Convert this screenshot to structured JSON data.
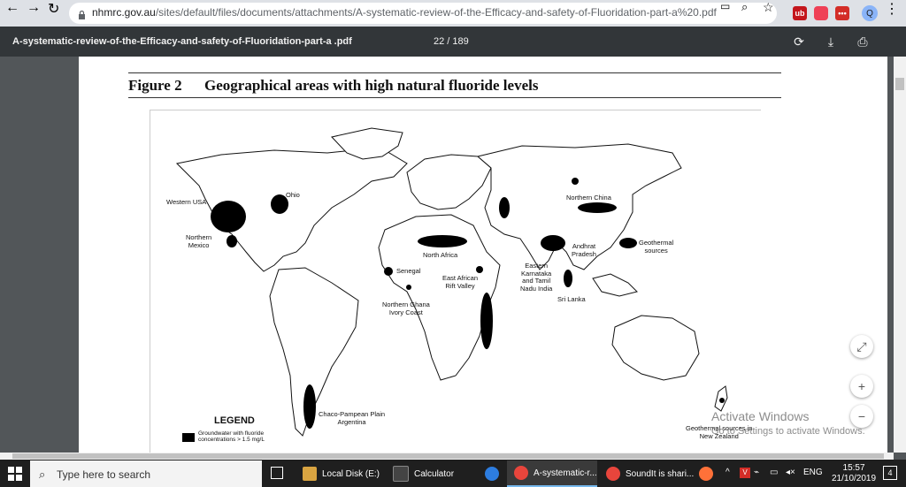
{
  "browser": {
    "url_domain": "nhmrc.gov.au",
    "url_path": "/sites/default/files/documents/attachments/A-systematic-review-of-the-Efficacy-and-safety-of-Fluoridation-part-a%20.pdf",
    "profile_initial": "Q",
    "extensions": [
      {
        "name": "ublock-icon",
        "label": "ub",
        "color": "#c4161c"
      },
      {
        "name": "pocket-icon",
        "label": "",
        "color": "#ef4056"
      },
      {
        "name": "lastpass-icon",
        "label": "•••",
        "color": "#d32d27"
      }
    ]
  },
  "pdf": {
    "title": "A-systematic-review-of-the-Efficacy-and-safety-of-Fluoridation-part-a .pdf",
    "page_indicator": "22 / 189"
  },
  "figure": {
    "label": "Figure 2",
    "caption": "Geographical areas with high natural fluoride levels",
    "regions": {
      "western_usa": "Western USA",
      "ohio": "Ohio",
      "northern_mexico_1": "Northern",
      "northern_mexico_2": "Mexico",
      "north_africa": "North Africa",
      "northern_china": "Northern China",
      "senegal": "Senegal",
      "east_african_1": "East African",
      "east_african_2": "Rift Valley",
      "andhra_1": "Andhrat",
      "andhra_2": "Pradesh",
      "eastern_1": "Eastern",
      "eastern_2": "Karnataka",
      "eastern_3": "and Tamil",
      "eastern_4": "Nadu India",
      "sri_lanka": "Sri Lanka",
      "geothermal_1": "Geothermal",
      "geothermal_2": "sources",
      "ghana_1": "Northern Ghana",
      "ghana_2": "Ivory Coast",
      "chaco_1": "Chaco-Pampean Plain",
      "chaco_2": "Argentina",
      "nz_1": "Geothermal sources in",
      "nz_2": "New Zealand"
    },
    "legend": {
      "title": "LEGEND",
      "item_1": "Groundwater with fluoride",
      "item_2": "concentrations > 1.5 mg/L"
    }
  },
  "watermark": {
    "line1": "Activate Windows",
    "line2": "Go to Settings to activate Windows."
  },
  "taskbar": {
    "search_placeholder": "Type here to search",
    "tasks": [
      {
        "name": "task-local-disk",
        "label": "Local Disk (E:)",
        "color": "#d9a441",
        "active": false
      },
      {
        "name": "task-calculator",
        "label": "Calculator",
        "color": "#444444",
        "active": false
      },
      {
        "name": "task-chrome-systematic",
        "label": "A-systematic-r...",
        "color": "#e8453c",
        "active": true
      },
      {
        "name": "task-chrome-soundit",
        "label": "SoundIt is shari...",
        "color": "#e8453c",
        "active": false
      }
    ],
    "tray": {
      "language": "ENG",
      "time": "15:57",
      "date": "21/10/2019",
      "notification_count": "4"
    }
  }
}
